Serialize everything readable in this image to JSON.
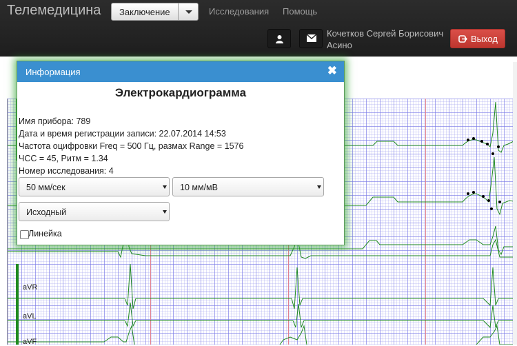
{
  "app": {
    "title": "Телемедицина"
  },
  "nav": {
    "dropdown_label": "Заключение",
    "links": [
      "Исследования",
      "Помощь"
    ]
  },
  "user": {
    "name_line1": "Кочетков Сергей Борисович",
    "name_line2": "Асино",
    "icons": [
      "user-icon",
      "envelope-icon"
    ]
  },
  "logout": {
    "label": "Выход",
    "icon": "logout-icon"
  },
  "modal": {
    "header": "Информация",
    "close_glyph": "✖",
    "title": "Электрокардиограмма",
    "info_lines": [
      "Имя прибора: 789",
      "Дата и время регистрации записи: 22.07.2014 14:53",
      "Частота оцифровки Freq = 500 Гц, размах Range = 1576",
      "ЧСС = 45, Ритм = 1.34",
      "Номер исследования: 4"
    ],
    "speed_select": "50 мм/сек",
    "gain_select": "10 мм/мВ",
    "filter_select": "Исходный",
    "ruler_label": "Линейка",
    "ruler_checked": false
  },
  "ecg": {
    "leads": [
      "aVR",
      "aVL",
      "aVF"
    ]
  },
  "colors": {
    "navbar": "#222222",
    "modal_header": "#3a8fd0",
    "logout_button": "#da4f49",
    "trace": "#1f8a1f",
    "marker_line": "#e08090"
  }
}
